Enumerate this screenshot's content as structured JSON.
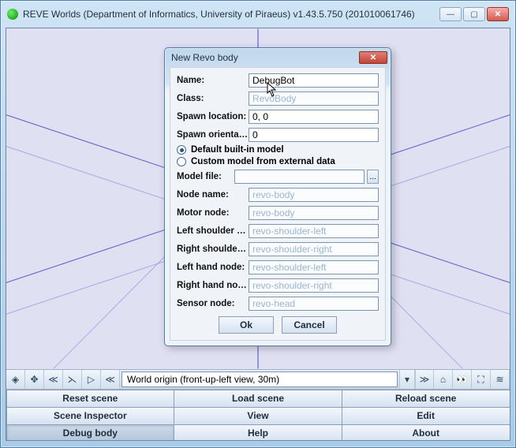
{
  "window": {
    "title": "REVE Worlds (Department of Informatics, University of Piraeus) v1.43.5.750 (201010061746)"
  },
  "nav": {
    "input_value": "World origin (front-up-left view, 30m)"
  },
  "buttons": {
    "reset": "Reset scene",
    "load": "Load scene",
    "reload": "Reload scene",
    "inspector": "Scene Inspector",
    "view": "View",
    "edit": "Edit",
    "debug": "Debug body",
    "help": "Help",
    "about": "About"
  },
  "dialog": {
    "title": "New Revo body",
    "labels": {
      "name": "Name:",
      "class": "Class:",
      "spawn_loc": "Spawn location:",
      "spawn_ori": "Spawn orientation:",
      "radio_default": "Default built-in model",
      "radio_custom": "Custom model from external data",
      "model_file": "Model file:",
      "node_name": "Node name:",
      "motor_node": "Motor node:",
      "left_sh": "Left shoulder no...",
      "right_sh": "Right shoulder n...",
      "left_hand": "Left hand node:",
      "right_hand": "Right hand node:",
      "sensor": "Sensor node:"
    },
    "fields": {
      "name": "DebugBot",
      "class": "RevoBody",
      "spawn_loc": "0, 0",
      "spawn_ori": "0",
      "model_file": "",
      "node_name": "revo-body",
      "motor_node": "revo-body",
      "left_sh": "revo-shoulder-left",
      "right_sh": "revo-shoulder-right",
      "left_hand": "revo-shoulder-left",
      "right_hand": "revo-shoulder-right",
      "sensor": "revo-head"
    },
    "radio_selected": "default",
    "buttons": {
      "ok": "Ok",
      "cancel": "Cancel"
    }
  }
}
